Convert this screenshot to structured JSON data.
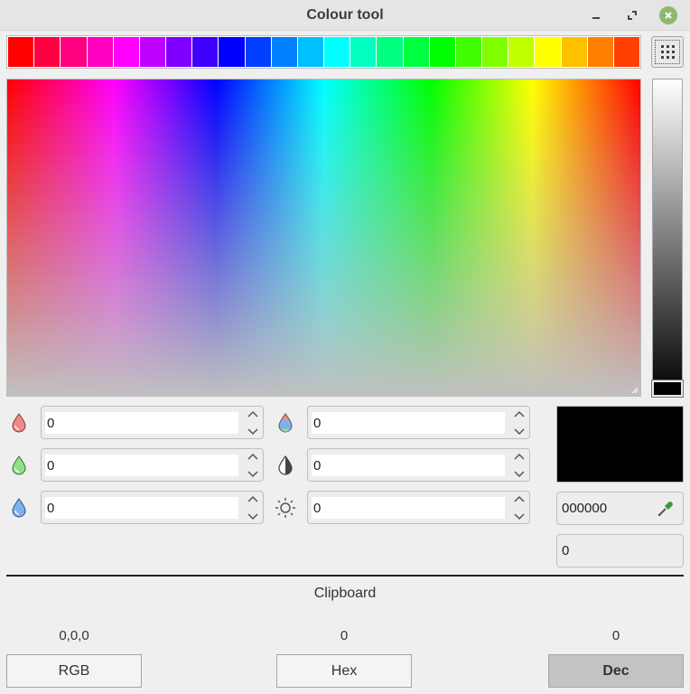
{
  "window": {
    "title": "Colour tool"
  },
  "swatches": [
    "#ff0000",
    "#ff0040",
    "#ff0080",
    "#ff00c0",
    "#ff00ff",
    "#c000ff",
    "#8000ff",
    "#4000ff",
    "#0000ff",
    "#0040ff",
    "#0080ff",
    "#00c0ff",
    "#00ffff",
    "#00ffc0",
    "#00ff80",
    "#00ff40",
    "#00ff00",
    "#40ff00",
    "#80ff00",
    "#c0ff00",
    "#ffff00",
    "#ffc000",
    "#ff8000",
    "#ff4000"
  ],
  "fields": {
    "red": "0",
    "green": "0",
    "blue": "0",
    "hue": "0",
    "saturation": "0",
    "luminance": "0"
  },
  "output": {
    "hex": "000000",
    "dec": "0",
    "preview_color": "#000000"
  },
  "clipboard": {
    "label": "Clipboard",
    "rgb_value": "0,0,0",
    "hex_value": "0",
    "dec_value": "0",
    "rgb_button": "RGB",
    "hex_button": "Hex",
    "dec_button": "Dec",
    "active_format": "Dec"
  }
}
